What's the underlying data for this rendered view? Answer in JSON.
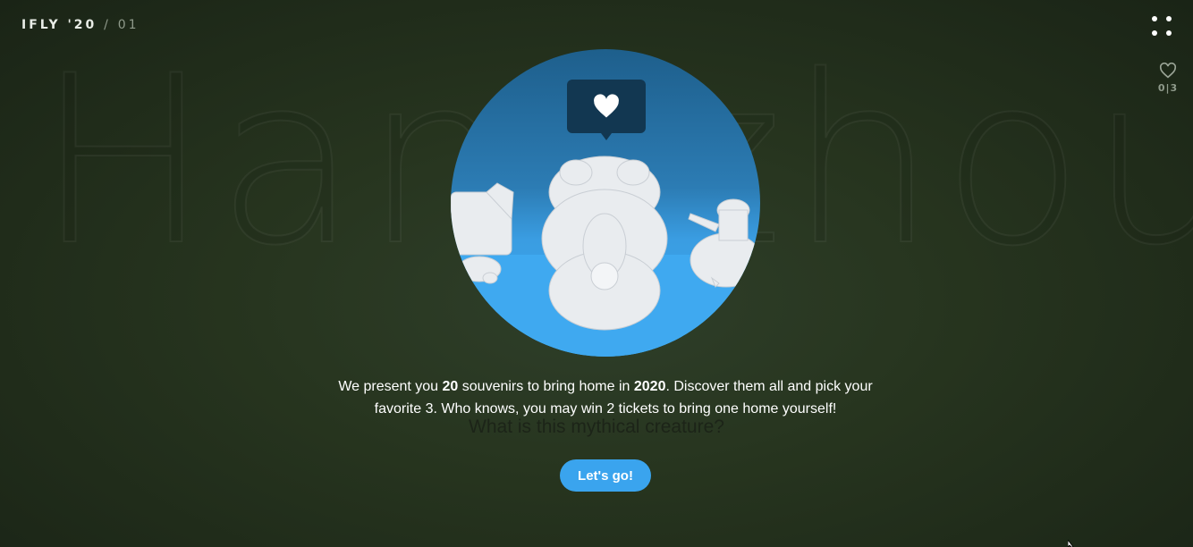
{
  "brand": {
    "name": "IFLY '20",
    "separator": "/",
    "page": "01"
  },
  "favorites": {
    "icon": "heart-outline-icon",
    "count": "0|3"
  },
  "background": {
    "word": "Hangzhou",
    "question": "What is this mythical creature?"
  },
  "hero": {
    "bubble_icon": "heart-icon",
    "accent": "#3aa4ee"
  },
  "intro": {
    "part1": "We present you ",
    "bold1": "20",
    "part2": " souvenirs to bring home in ",
    "bold2": "2020",
    "part3": ". Discover them all and pick your favorite 3. Who knows, you may win 2 tickets to bring one home yourself!"
  },
  "cta": {
    "label": "Let's go!"
  }
}
